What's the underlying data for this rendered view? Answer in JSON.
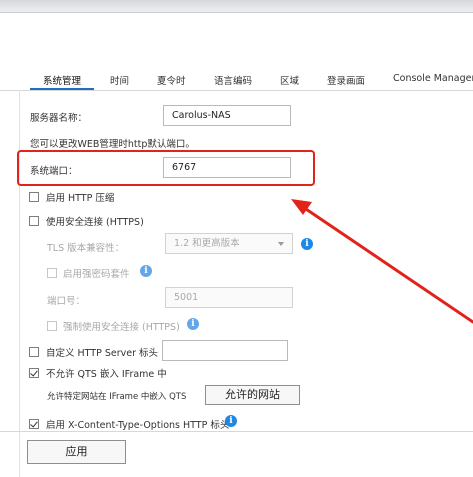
{
  "tabs": [
    {
      "label": "系统管理"
    },
    {
      "label": "时间"
    },
    {
      "label": "夏令时"
    },
    {
      "label": "语言编码"
    },
    {
      "label": "区域"
    },
    {
      "label": "登录画面"
    },
    {
      "label": "Console Managem"
    }
  ],
  "server_name": {
    "label": "服务器名称：",
    "value": "Carolus-NAS"
  },
  "http_port_note": "您可以更改WEB管理时http默认端口。",
  "system_port": {
    "label": "系统端口：",
    "value": "6767"
  },
  "http_compression": {
    "label": "启用 HTTP 压缩",
    "checked": false
  },
  "https": {
    "label": "使用安全连接 (HTTPS)",
    "checked": false
  },
  "tls": {
    "label": "TLS 版本兼容性：",
    "value": "1.2 和更高版本"
  },
  "strong_cipher": {
    "label": "启用强密码套件"
  },
  "port_number": {
    "label": "端口号：",
    "value": "5001"
  },
  "force_secure": {
    "label": "强制使用安全连接 (HTTPS)"
  },
  "custom_header": {
    "label": "自定义 HTTP Server 标头",
    "value": ""
  },
  "no_iframe": {
    "label": "不允许 QTS 嵌入 IFrame 中",
    "checked": true
  },
  "iframe_allow": {
    "label": "允许特定网站在 IFrame 中嵌入 QTS",
    "button": "允许的网站"
  },
  "xcto": {
    "label": "启用 X-Content-Type-Options HTTP 标头",
    "checked": true
  },
  "apply_button": "应用",
  "colors": {
    "accent": "#1e6fc3",
    "highlight": "#e2231a",
    "info": "#1e88e5"
  },
  "icons": {
    "info": "info-icon",
    "caret": "chevron-down-icon",
    "arrow": "red-arrow"
  }
}
